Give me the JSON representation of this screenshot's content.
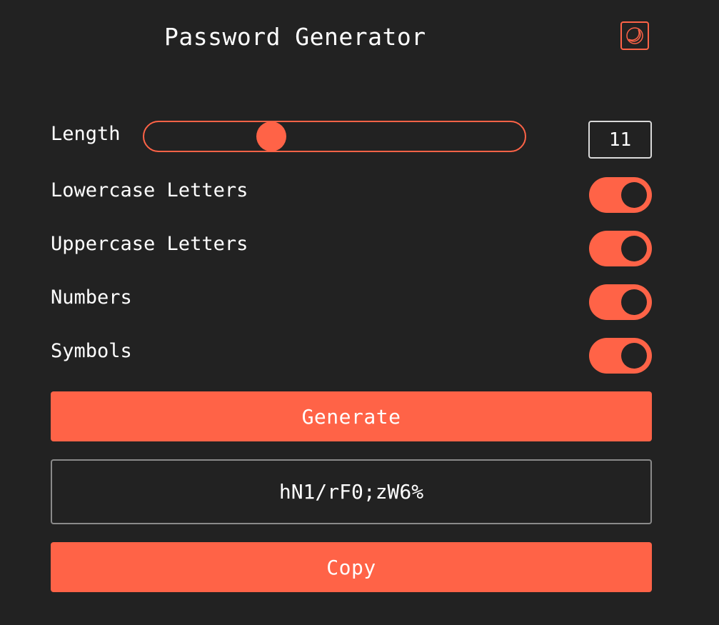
{
  "header": {
    "title": "Password Generator",
    "theme_icon": "half-moon-icon"
  },
  "options": {
    "length_label": "Length",
    "length_value": "11",
    "length_slider_fraction": 0.32,
    "lowercase_label": "Lowercase Letters",
    "lowercase_on": true,
    "uppercase_label": "Uppercase Letters",
    "uppercase_on": true,
    "numbers_label": "Numbers",
    "numbers_on": true,
    "symbols_label": "Symbols",
    "symbols_on": true
  },
  "actions": {
    "generate_label": "Generate",
    "copy_label": "Copy"
  },
  "result": {
    "password": "hN1/rF0;zW6%"
  },
  "colors": {
    "accent": "#ff6347",
    "background": "#222222",
    "text": "#ffffff"
  }
}
